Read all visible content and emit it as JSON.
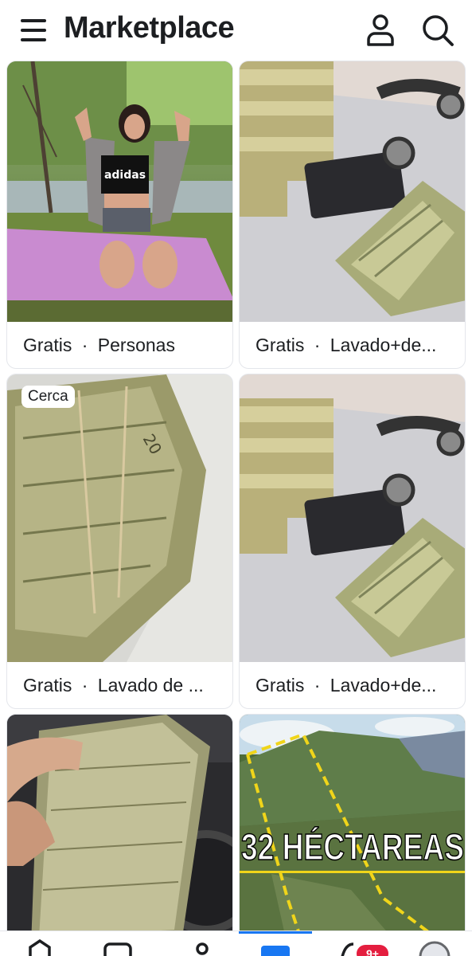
{
  "header": {
    "title": "Marketplace"
  },
  "icons": {
    "menu": "hamburger-menu-icon",
    "profile": "person-icon",
    "search": "search-icon"
  },
  "listings": [
    {
      "price": "Gratis",
      "separator": "·",
      "title": "Personas",
      "badge": ""
    },
    {
      "price": "Gratis",
      "separator": "·",
      "title": "Lavado+de...",
      "badge": ""
    },
    {
      "price": "Gratis",
      "separator": "·",
      "title": "Lavado de ...",
      "badge": "Cerca"
    },
    {
      "price": "Gratis",
      "separator": "·",
      "title": "Lavado+de...",
      "badge": ""
    },
    {
      "price": "",
      "separator": "",
      "title": "",
      "badge": ""
    },
    {
      "price": "",
      "separator": "",
      "title": "",
      "badge": "",
      "overlay_text": "32 HÉCTAREAS"
    }
  ],
  "bottom_nav": {
    "notification_count": "9+"
  },
  "colors": {
    "text": "#1c1e21",
    "border": "#e4e6eb",
    "accent": "#1877f2",
    "badge": "#e41e3f"
  }
}
